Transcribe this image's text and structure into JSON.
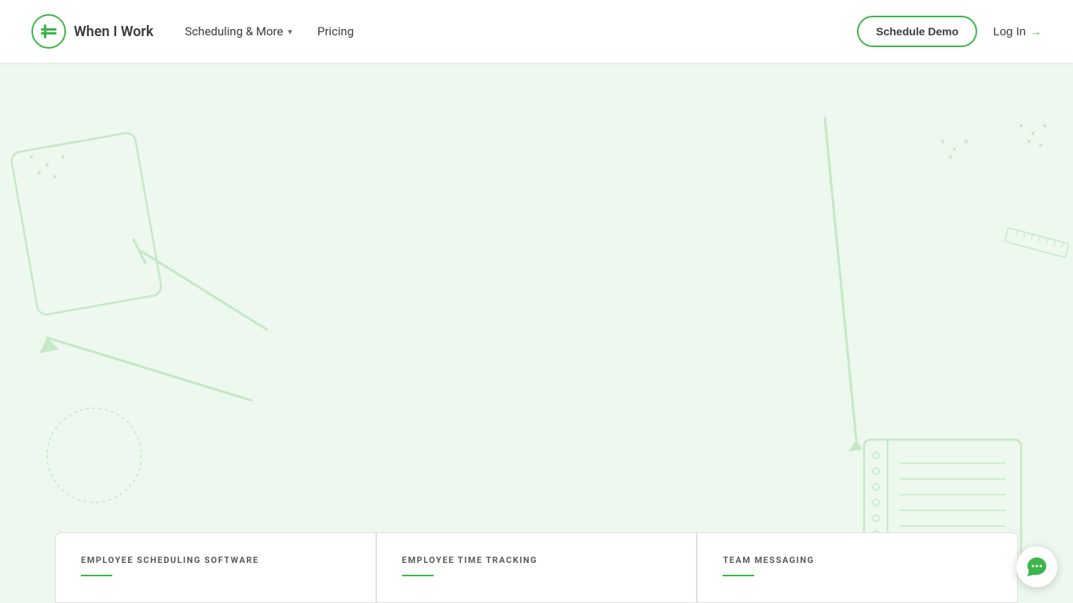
{
  "nav": {
    "logo_text": "When I Work",
    "links": [
      {
        "label": "Scheduling & More",
        "has_dropdown": true
      },
      {
        "label": "Pricing",
        "has_dropdown": false
      }
    ],
    "cta_button": "Schedule Demo",
    "login_label": "Log In"
  },
  "hero": {
    "background_color": "#edf8ee"
  },
  "feature_cards": [
    {
      "title": "EMPLOYEE SCHEDULING SOFTWARE"
    },
    {
      "title": "EMPLOYEE TIME TRACKING"
    },
    {
      "title": "TEAM MESSAGING"
    }
  ],
  "chat": {
    "icon_label": "chat-icon"
  }
}
